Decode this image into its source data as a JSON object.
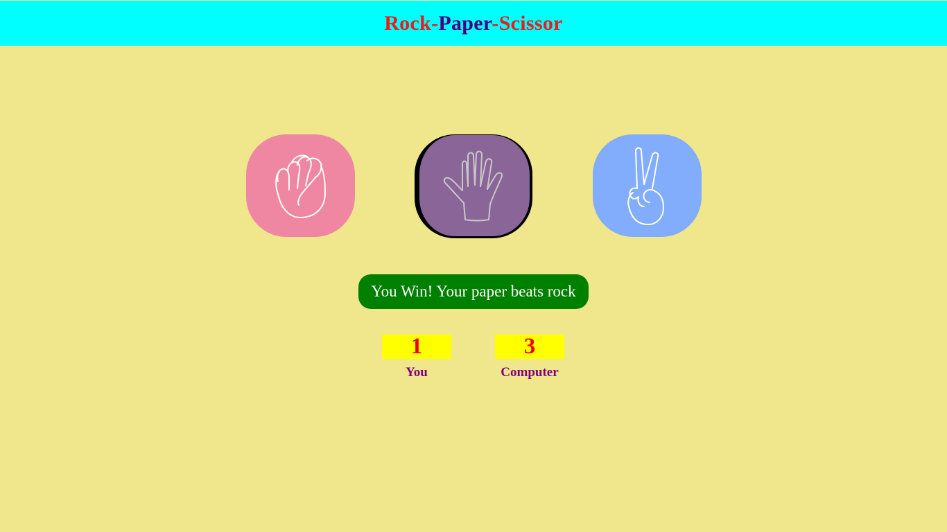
{
  "title": {
    "part1": "Rock",
    "dash1": "-",
    "part2": "Paper",
    "dash2": "-",
    "part3": "Scissor"
  },
  "choices": [
    {
      "id": "rock",
      "icon": "rock-hand-icon",
      "color": "#ef87a3"
    },
    {
      "id": "paper",
      "icon": "paper-hand-icon",
      "color": "#8a6598",
      "selected": true
    },
    {
      "id": "scissor",
      "icon": "scissor-hand-icon",
      "color": "#82adfc"
    }
  ],
  "message": {
    "text": "You Win! Your paper beats rock",
    "color": "#008000"
  },
  "score": {
    "user": {
      "value": "1",
      "label": "You"
    },
    "computer": {
      "value": "3",
      "label": "Computer"
    },
    "box_color": "#ffff00"
  },
  "colors": {
    "background": "#f0e68c",
    "header": "#00ffff"
  }
}
